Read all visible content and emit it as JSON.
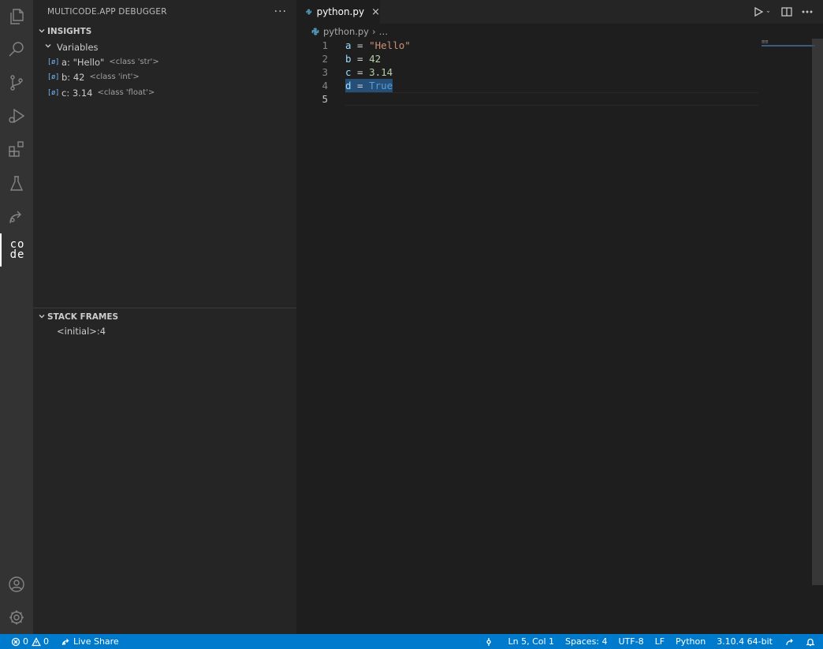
{
  "sidebar": {
    "title": "MULTICODE.APP DEBUGGER",
    "more": "···",
    "insights": {
      "header": "INSIGHTS",
      "variables_label": "Variables",
      "variables": [
        {
          "name": "a: \"Hello\"",
          "type": "<class 'str'>"
        },
        {
          "name": "b: 42",
          "type": "<class 'int'>"
        },
        {
          "name": "c: 3.14",
          "type": "<class 'float'>"
        }
      ],
      "var_icon": "[ø]"
    },
    "stack_frames": {
      "header": "STACK FRAMES",
      "items": [
        "<initial>:4"
      ]
    }
  },
  "activity_bar": {
    "items": [
      "explorer-icon",
      "search-icon",
      "source-control-icon",
      "run-debug-icon",
      "extensions-icon",
      "testing-icon",
      "live-share-icon",
      "multicode-icon"
    ],
    "bottom": [
      "accounts-icon",
      "manage-gear-icon"
    ],
    "multicode_logo_top": "co",
    "multicode_logo_bottom": "de"
  },
  "editor": {
    "tab": {
      "label": "python.py",
      "close": "×"
    },
    "breadcrumb": {
      "file": "python.py",
      "more": "…"
    },
    "minimap_dots": "≡≡",
    "lines": [
      {
        "num": "1",
        "var": "a",
        "op": " = ",
        "val": "\"Hello\"",
        "kind": "string"
      },
      {
        "num": "2",
        "var": "b",
        "op": " = ",
        "val": "42",
        "kind": "number"
      },
      {
        "num": "3",
        "var": "c",
        "op": " = ",
        "val": "3.14",
        "kind": "number"
      },
      {
        "num": "4",
        "var": "d",
        "op": " = ",
        "val": "True",
        "kind": "keyword"
      },
      {
        "num": "5",
        "var": "",
        "op": "",
        "val": "",
        "kind": "empty"
      }
    ]
  },
  "statusbar": {
    "errors": "0",
    "warnings": "0",
    "live_share": "Live Share",
    "position": "Ln 5, Col 1",
    "spaces": "Spaces: 4",
    "encoding": "UTF-8",
    "eol": "LF",
    "language": "Python",
    "interpreter": "3.10.4 64-bit"
  },
  "colors": {
    "accent": "#007acc",
    "selection": "#264f78",
    "variable": "#9cdcfe",
    "string": "#ce9178",
    "number": "#b5cea8",
    "keyword": "#569cd6"
  }
}
